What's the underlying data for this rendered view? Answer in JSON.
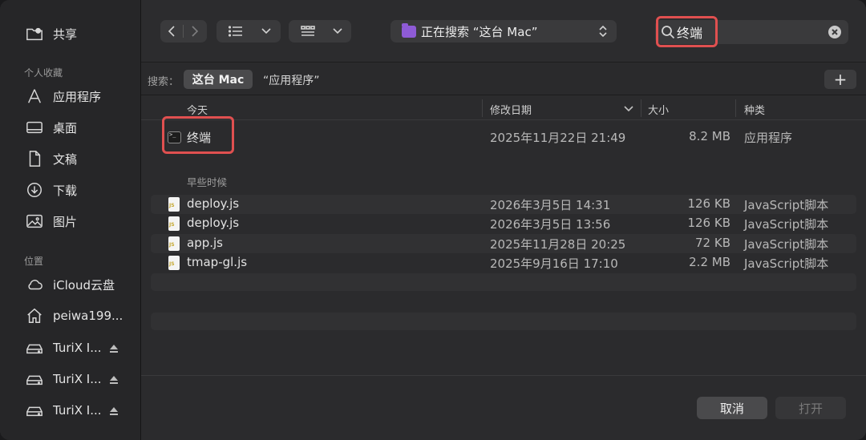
{
  "sidebar": {
    "share": {
      "label": "共享",
      "icon": "shared-folder-icon"
    },
    "favorites_heading": "个人收藏",
    "favorites": [
      {
        "label": "应用程序",
        "icon": "applications-icon"
      },
      {
        "label": "桌面",
        "icon": "desktop-icon"
      },
      {
        "label": "文稿",
        "icon": "document-icon"
      },
      {
        "label": "下载",
        "icon": "download-icon"
      },
      {
        "label": "图片",
        "icon": "pictures-icon"
      }
    ],
    "locations_heading": "位置",
    "locations": [
      {
        "label": "iCloud云盘",
        "icon": "cloud-icon"
      },
      {
        "label": "peiwa199...",
        "icon": "home-icon"
      },
      {
        "label": "TuriX I...",
        "icon": "drive-icon",
        "eject": true
      },
      {
        "label": "TuriX I...",
        "icon": "drive-icon",
        "eject": true
      },
      {
        "label": "TuriX I...",
        "icon": "drive-icon",
        "eject": true
      }
    ]
  },
  "toolbar": {
    "location": "正在搜索 “这台 Mac”"
  },
  "search": {
    "value": "终端",
    "placeholder": ""
  },
  "scope": {
    "label": "搜索：",
    "active": "这台 Mac",
    "other": "“应用程序”",
    "add": "+"
  },
  "columns": {
    "name": "今天",
    "date": "修改日期",
    "size": "大小",
    "kind": "种类"
  },
  "today": {
    "name": "终端",
    "date": "2025年11月22日 21:49",
    "size": "8.2 MB",
    "kind": "应用程序"
  },
  "earlier_heading": "早些时候",
  "files": [
    {
      "name": "deploy.js",
      "date": "2026年3月5日 14:31",
      "size": "126 KB",
      "kind": "JavaScript脚本"
    },
    {
      "name": "deploy.js",
      "date": "2026年3月5日 13:56",
      "size": "126 KB",
      "kind": "JavaScript脚本"
    },
    {
      "name": "app.js",
      "date": "2025年11月28日 20:25",
      "size": "72 KB",
      "kind": "JavaScript脚本"
    },
    {
      "name": "tmap-gl.js",
      "date": "2025年9月16日 17:10",
      "size": "2.2 MB",
      "kind": "JavaScript脚本"
    }
  ],
  "footer": {
    "cancel": "取消",
    "open": "打开"
  },
  "colors": {
    "highlight": "#e05050",
    "folder_accent": "#8e5bd6"
  }
}
